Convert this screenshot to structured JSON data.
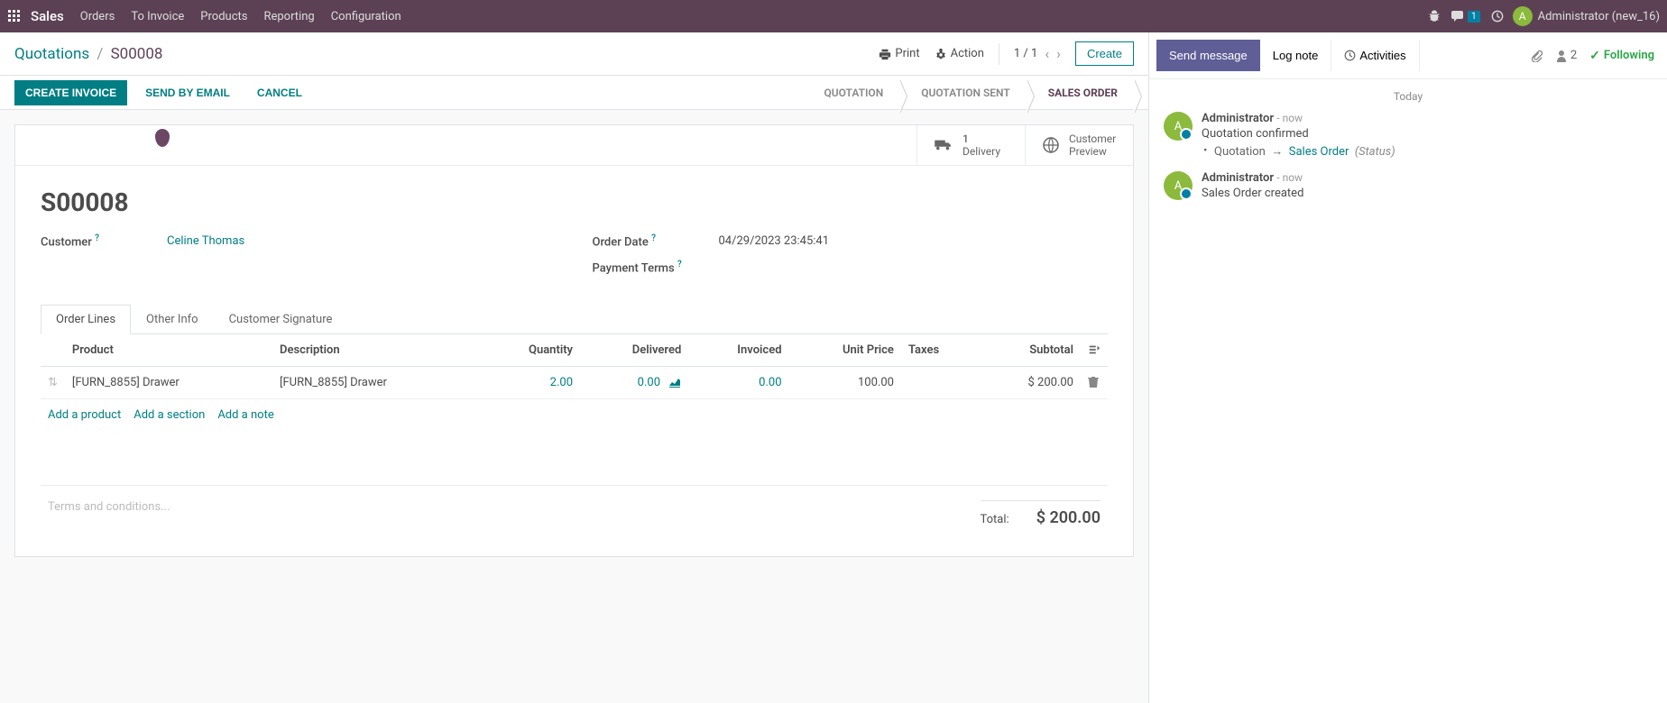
{
  "topbar": {
    "app_name": "Sales",
    "menus": [
      "Orders",
      "To Invoice",
      "Products",
      "Reporting",
      "Configuration"
    ],
    "chat_count": "1",
    "user_initial": "A",
    "user_name": "Administrator (new_16)"
  },
  "breadcrumb": {
    "parent": "Quotations",
    "current": "S00008"
  },
  "control": {
    "print": "Print",
    "action": "Action",
    "pager": "1 / 1",
    "create": "Create"
  },
  "status_buttons": {
    "create_invoice": "CREATE INVOICE",
    "send_email": "SEND BY EMAIL",
    "cancel": "CANCEL"
  },
  "status_steps": [
    "QUOTATION",
    "QUOTATION SENT",
    "SALES ORDER"
  ],
  "active_step": 2,
  "button_boxes": {
    "delivery_count": "1",
    "delivery_label": "Delivery",
    "preview_label1": "Customer",
    "preview_label2": "Preview"
  },
  "doc": {
    "name": "S00008",
    "customer_label": "Customer",
    "customer": "Celine Thomas",
    "order_date_label": "Order Date",
    "order_date": "04/29/2023 23:45:41",
    "payment_terms_label": "Payment Terms"
  },
  "tabs": [
    "Order Lines",
    "Other Info",
    "Customer Signature"
  ],
  "active_tab": 0,
  "columns": {
    "product": "Product",
    "description": "Description",
    "quantity": "Quantity",
    "delivered": "Delivered",
    "invoiced": "Invoiced",
    "unit_price": "Unit Price",
    "taxes": "Taxes",
    "subtotal": "Subtotal"
  },
  "lines": [
    {
      "product": "[FURN_8855] Drawer",
      "description": "[FURN_8855] Drawer",
      "quantity": "2.00",
      "delivered": "0.00",
      "invoiced": "0.00",
      "unit_price": "100.00",
      "taxes": "",
      "subtotal": "$ 200.00"
    }
  ],
  "line_actions": {
    "add_product": "Add a product",
    "add_section": "Add a section",
    "add_note": "Add a note"
  },
  "terms_placeholder": "Terms and conditions...",
  "totals": {
    "total_label": "Total:",
    "total": "$ 200.00"
  },
  "chatter": {
    "send_message": "Send message",
    "log_note": "Log note",
    "activities": "Activities",
    "followers": "2",
    "following": "Following",
    "date_group": "Today",
    "messages": [
      {
        "author": "Administrator",
        "time": "now",
        "text": "Quotation confirmed",
        "track_field": "Quotation",
        "track_new": "Sales Order",
        "track_status": "(Status)"
      },
      {
        "author": "Administrator",
        "time": "now",
        "text": "Sales Order created"
      }
    ]
  }
}
